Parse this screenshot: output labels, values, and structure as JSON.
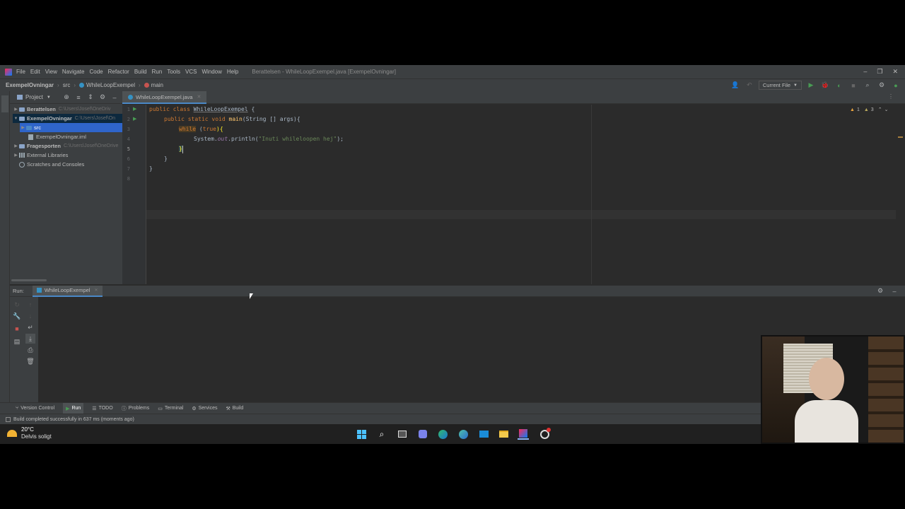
{
  "window": {
    "title": "Berattelsen - WhileLoopExempel.java [ExempelOvningar]",
    "menu": [
      "File",
      "Edit",
      "View",
      "Navigate",
      "Code",
      "Refactor",
      "Build",
      "Run",
      "Tools",
      "VCS",
      "Window",
      "Help"
    ]
  },
  "breadcrumb": {
    "items": [
      "ExempelOvningar",
      "src",
      "WhileLoopExempel",
      "main"
    ],
    "run_config": "Current File"
  },
  "project_panel": {
    "title": "Project",
    "tree": [
      {
        "label": "Berattelsen",
        "path": "C:\\Users\\Josef\\OneDriv"
      },
      {
        "label": "ExempelOvningar",
        "path": "C:\\Users\\Josef\\On"
      },
      {
        "label": "src",
        "path": ""
      },
      {
        "label": "ExempelOvningar.iml",
        "path": ""
      },
      {
        "label": "Fragesporten",
        "path": "C:\\Users\\Josef\\OneDrive"
      },
      {
        "label": "External Libraries",
        "path": ""
      },
      {
        "label": "Scratches and Consoles",
        "path": ""
      }
    ]
  },
  "editor": {
    "tab": "WhileLoopExempel.java",
    "line_numbers": [
      "1",
      "2",
      "3",
      "4",
      "5",
      "6",
      "7",
      "8"
    ],
    "inspection": {
      "warnings": "1",
      "weak": "3"
    },
    "code": {
      "l1_kw": "public class ",
      "l1_name": "WhileLoopExempel",
      "l1_rest": " {",
      "l2_kw": "public static void ",
      "l2_name": "main",
      "l2_rest": "(String [] args){",
      "l3_kw": "while",
      "l3_paren": " (",
      "l3_true": "true",
      "l3_rest": "){",
      "l4_sys": "System.",
      "l4_out": "out",
      "l4_call": ".println(",
      "l4_str": "\"Inuti whileloopen hej\"",
      "l4_end": ");",
      "l5": "}",
      "l6": "}",
      "l7": "}"
    }
  },
  "run_panel": {
    "label": "Run:",
    "tab": "WhileLoopExempel"
  },
  "bottom_tabs": [
    "Version Control",
    "Run",
    "TODO",
    "Problems",
    "Terminal",
    "Services",
    "Build"
  ],
  "status": {
    "message": "Build completed successfully in 637 ms (moments ago)"
  },
  "taskbar": {
    "weather_temp": "20°C",
    "weather_desc": "Delvis soligt"
  },
  "colors": {
    "accent": "#4a88c7",
    "run_green": "#499c54",
    "stop_red": "#c75450"
  }
}
